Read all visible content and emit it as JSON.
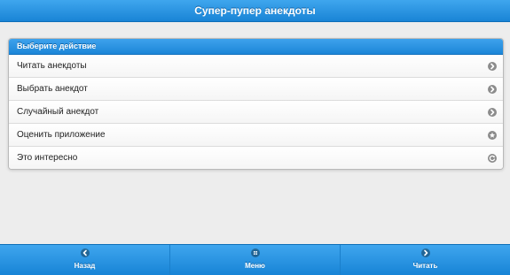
{
  "header": {
    "title": "Супер-пупер анекдоты"
  },
  "menu": {
    "divider": "Выберите действие",
    "items": [
      {
        "label": "Читать анекдоты",
        "icon": "arrow-right-icon"
      },
      {
        "label": "Выбрать анекдот",
        "icon": "arrow-right-icon"
      },
      {
        "label": "Случайный анекдот",
        "icon": "arrow-right-icon"
      },
      {
        "label": "Оценить приложение",
        "icon": "star-icon"
      },
      {
        "label": "Это интересно",
        "icon": "refresh-icon"
      }
    ]
  },
  "footer": {
    "buttons": [
      {
        "label": "Назад",
        "icon": "arrow-left-icon"
      },
      {
        "label": "Меню",
        "icon": "grid-icon"
      },
      {
        "label": "Читать",
        "icon": "arrow-right-icon"
      }
    ]
  },
  "colors": {
    "accent": "#1e88d8",
    "background": "#ededed",
    "icon": "#8c8c8c"
  }
}
